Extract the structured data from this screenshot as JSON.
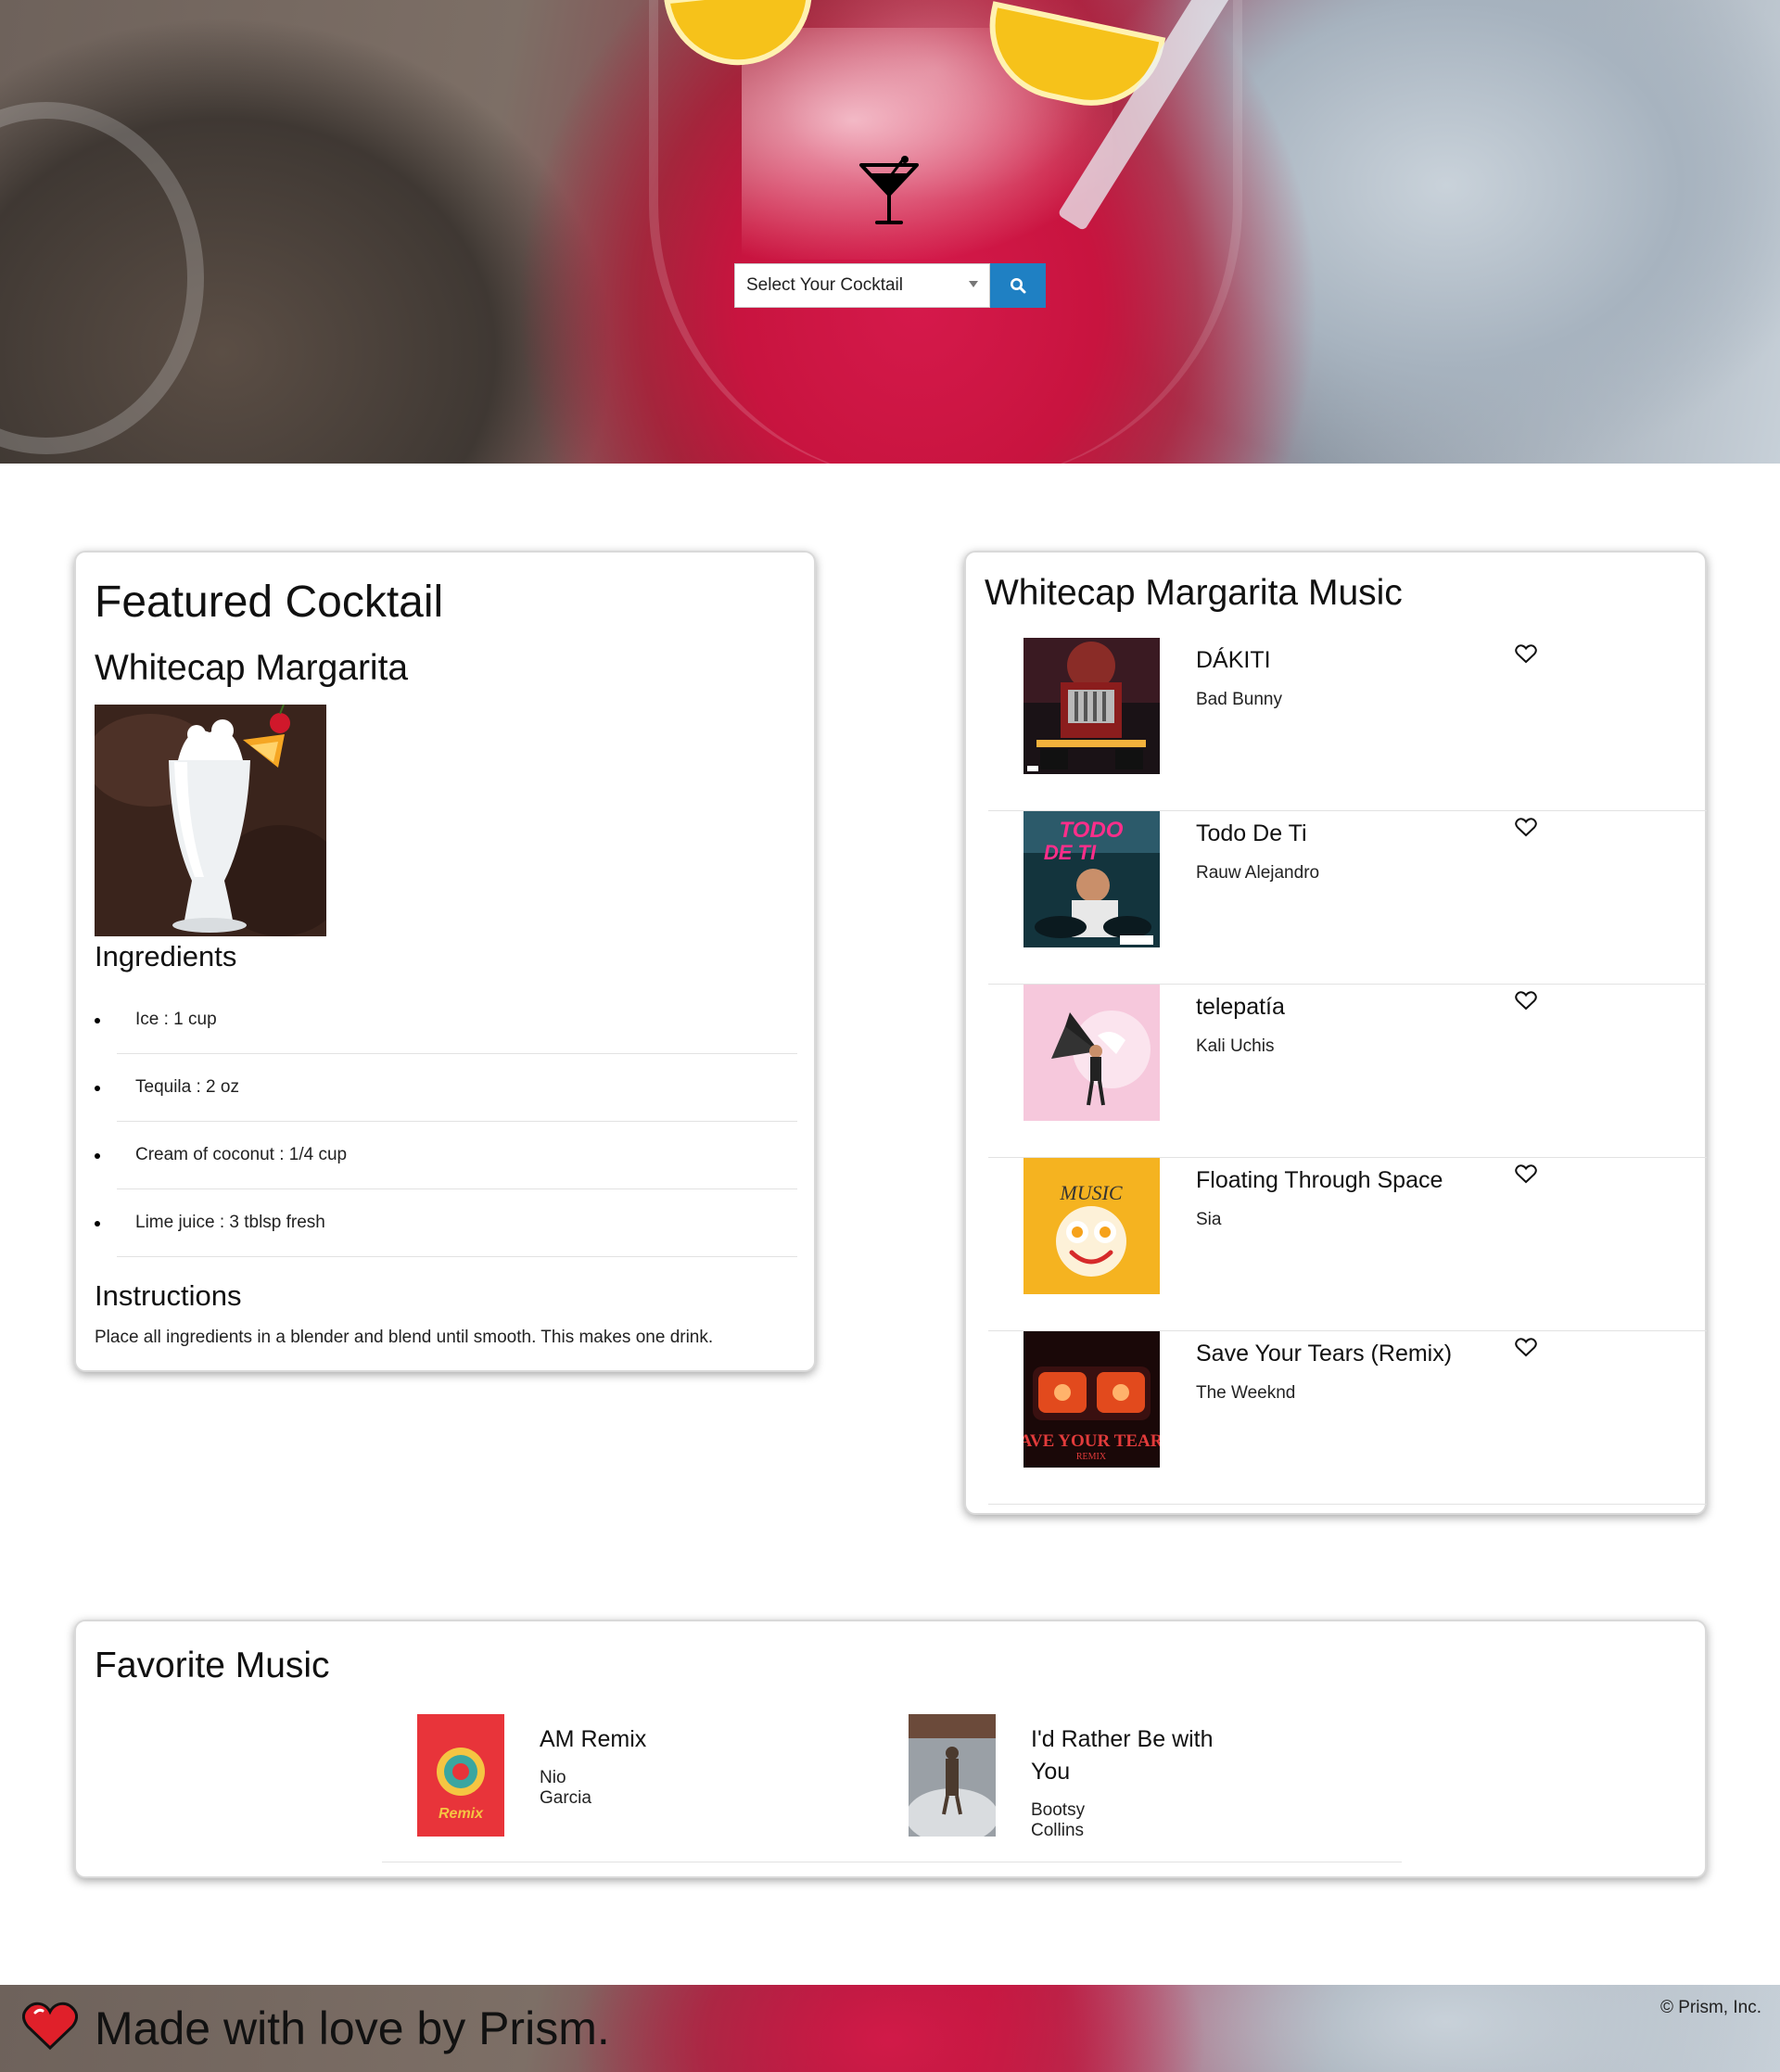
{
  "search": {
    "placeholder": "Select Your Cocktail",
    "button_icon": "search-icon"
  },
  "featured": {
    "heading": "Featured Cocktail",
    "cocktail_name": "Whitecap Margarita",
    "ingredients_heading": "Ingredients",
    "ingredients": [
      "Ice : 1 cup",
      "Tequila : 2 oz",
      "Cream of coconut : 1/4 cup",
      "Lime juice : 3 tblsp fresh"
    ],
    "instructions_heading": "Instructions",
    "instructions": "Place all ingredients in a blender and blend until smooth. This makes one drink."
  },
  "music": {
    "heading": "Whitecap Margarita Music",
    "tracks": [
      {
        "title": "DÁKITI",
        "artist": "Bad Bunny"
      },
      {
        "title": "Todo De Ti",
        "artist": "Rauw Alejandro"
      },
      {
        "title": "telepatía",
        "artist": "Kali Uchis"
      },
      {
        "title": "Floating Through Space",
        "artist": "Sia"
      },
      {
        "title": "Save Your Tears (Remix)",
        "artist": "The Weeknd"
      }
    ]
  },
  "favorites": {
    "heading": "Favorite Music",
    "tracks": [
      {
        "title": "AM Remix",
        "artist": "Nio Garcia"
      },
      {
        "title": "I'd Rather Be with You",
        "artist": "Bootsy Collins"
      }
    ]
  },
  "footer": {
    "made_with": "Made with love by Prism.",
    "copyright": "© Prism, Inc."
  },
  "colors": {
    "search_button": "#1f80c3",
    "heart_logo": "#e0202a"
  }
}
